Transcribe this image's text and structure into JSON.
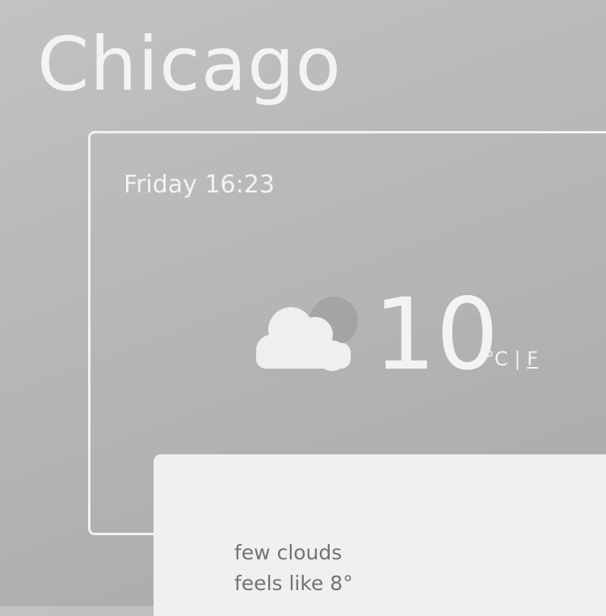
{
  "city": "Chicago",
  "datetime": "Friday 16:23",
  "current": {
    "temperature": "10",
    "icon": "few-clouds-icon",
    "units": {
      "degree_celsius": "°C",
      "separator": "|",
      "fahrenheit": "F"
    }
  },
  "details": {
    "description": "few clouds",
    "feels_like": "feels like 8°"
  },
  "colors": {
    "background": "#b4b4b4",
    "text_light": "#f3f3f3",
    "panel": "#f0f0f0",
    "panel_text": "#737373"
  }
}
